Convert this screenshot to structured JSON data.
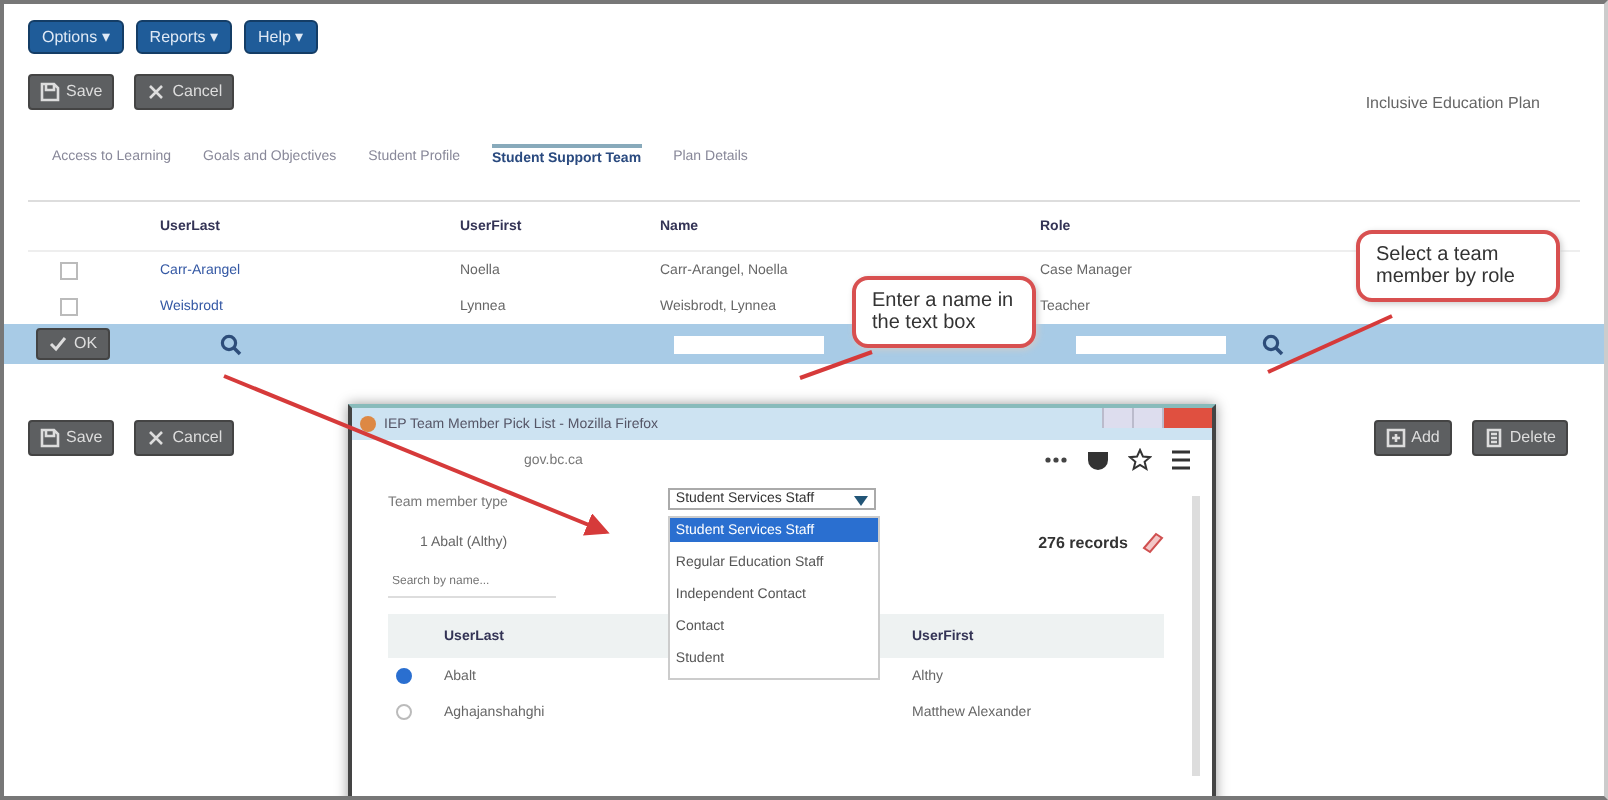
{
  "menu_buttons": [
    {
      "label": "Options ▾"
    },
    {
      "label": "Reports ▾"
    },
    {
      "label": "Help ▾"
    }
  ],
  "top_buttons": [
    {
      "label": "Save",
      "kind": "save"
    },
    {
      "label": "Cancel",
      "kind": "cancel"
    }
  ],
  "plan_title": "Inclusive Education Plan",
  "tabs": [
    {
      "label": "Access to Learning",
      "selected": false
    },
    {
      "label": "Goals and Objectives",
      "selected": false
    },
    {
      "label": "Student Profile",
      "selected": false
    },
    {
      "label": "Student Support Team",
      "selected": true
    },
    {
      "label": "Plan Details",
      "selected": false
    }
  ],
  "table": {
    "columns": [
      "UserLast",
      "UserFirst",
      "Name",
      "Role"
    ],
    "rows": [
      {
        "cells": [
          "Carr-Arangel",
          "Noella",
          "Carr-Arangel, Noella",
          "Case Manager"
        ],
        "checked": false
      },
      {
        "cells": [
          "Weisbrodt",
          "Lynnea",
          "Weisbrodt, Lynnea",
          "Teacher"
        ],
        "checked": false
      }
    ]
  },
  "edit_row": {
    "ok_label": "OK"
  },
  "bottom_buttons": [
    {
      "label": "Save",
      "kind": "save"
    },
    {
      "label": "Cancel",
      "kind": "cancel"
    }
  ],
  "side_buttons": [
    {
      "label": "Add",
      "kind": "add"
    },
    {
      "label": "Delete",
      "kind": "delete"
    }
  ],
  "callouts": [
    {
      "text": "Enter a name in the text box"
    },
    {
      "text": "Select a team member by role"
    }
  ],
  "popup": {
    "title": "IEP Team Member Pick List - Mozilla Firefox",
    "url": "gov.bc.ca",
    "type_label": "Team member type",
    "type_value": "Student Services Staff",
    "options": [
      {
        "label": "Student Services Staff",
        "selected": true
      },
      {
        "label": "Regular Education Staff",
        "selected": false
      },
      {
        "label": "Independent Contact",
        "selected": false
      },
      {
        "label": "Contact",
        "selected": false
      },
      {
        "label": "Student",
        "selected": false
      }
    ],
    "selected_person": "1 Abalt (Althy)",
    "search_placeholder": "Search by name...",
    "records": "276 records",
    "columns": [
      "UserLast",
      "UserFirst"
    ],
    "rows": [
      {
        "cells": [
          "Abalt",
          "Althy"
        ],
        "selected": true
      },
      {
        "cells": [
          "Aghajanshahghi",
          "Matthew Alexander"
        ],
        "selected": false
      }
    ]
  }
}
